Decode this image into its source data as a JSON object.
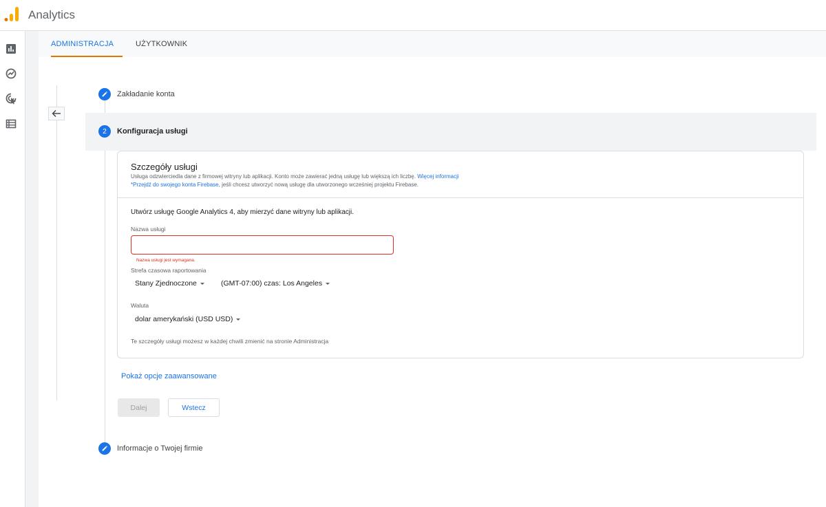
{
  "header": {
    "app_title": "Analytics",
    "logo_colors": [
      "#f9ab00",
      "#e37400"
    ]
  },
  "rail": {
    "icons": [
      "reports-icon",
      "explore-icon",
      "advertising-icon",
      "configure-icon"
    ]
  },
  "tabs": [
    {
      "label": "ADMINISTRACJA",
      "active": true
    },
    {
      "label": "UŻYTKOWNIK",
      "active": false
    }
  ],
  "steps": {
    "step1": {
      "label": "Zakładanie konta",
      "state": "done"
    },
    "step2": {
      "label": "Konfiguracja usługi",
      "number": "2",
      "state": "active"
    },
    "step3": {
      "label": "Informacje o Twojej firmie",
      "state": "done"
    }
  },
  "card": {
    "title": "Szczegóły usługi",
    "desc": "Usługa odzwierciedla dane z firmowej witryny lub aplikacji. Konto może zawierać jedną usługę lub większą ich liczbę.",
    "more_info_link": "Więcej informacji",
    "firebase_link": "*Przejdź do swojego konta Firebase",
    "firebase_rest": ", jeśli chcesz utworzyć nową usługę dla utworzonego wcześniej projektu Firebase.",
    "intro": "Utwórz usługę Google Analytics 4, aby mierzyć dane witryny lub aplikacji.",
    "name_label": "Nazwa usługi",
    "name_value": "",
    "name_error": "Nazwa usługi jest wymagana.",
    "timezone_label": "Strefa czasowa raportowania",
    "country_value": "Stany Zjednoczone",
    "timezone_value": "(GMT-07:00) czas: Los Angeles",
    "currency_label": "Waluta",
    "currency_value": "dolar amerykański (USD USD)",
    "footer_note": "Te szczegóły usługi możesz w każdej chwili zmienić na stronie Administracja"
  },
  "advanced_link": "Pokaż opcje zaawansowane",
  "buttons": {
    "next": "Dalej",
    "back": "Wstecz"
  },
  "colors": {
    "accent": "#1a73e8",
    "error": "#d93025",
    "tab_underline": "#e37400"
  }
}
